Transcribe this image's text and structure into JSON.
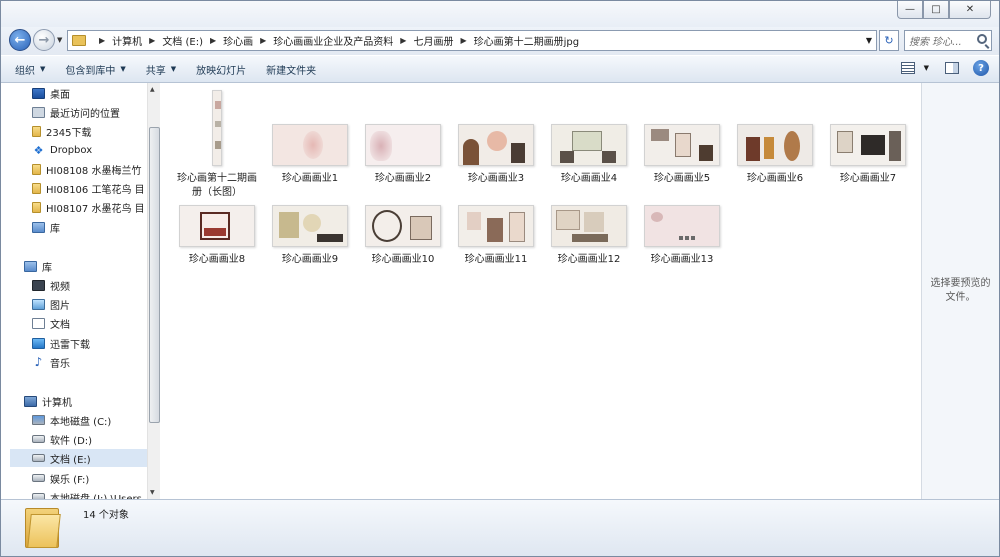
{
  "window": {
    "controls": {
      "minimize": "—",
      "maximize": "□",
      "close": "✕"
    }
  },
  "address": {
    "segments": [
      "计算机",
      "文档 (E:)",
      "珍心画",
      "珍心画画业企业及产品资料",
      "七月画册",
      "珍心画第十二期画册jpg"
    ],
    "search_placeholder": "搜索 珍心..."
  },
  "toolbar": {
    "organize": "组织",
    "include_library": "包含到库中",
    "share": "共享",
    "slideshow": "放映幻灯片",
    "new_folder": "新建文件夹"
  },
  "sidebar": {
    "items": [
      {
        "label": "桌面",
        "icon": "desktop-icon"
      },
      {
        "label": "最近访问的位置",
        "icon": "recent-places-icon"
      },
      {
        "label": "2345下载",
        "icon": "folder-icon"
      },
      {
        "label": "Dropbox",
        "icon": "dropbox-icon"
      },
      {
        "label": "HI08108 水墨梅兰竹",
        "icon": "folder-icon"
      },
      {
        "label": "HI08106 工笔花鸟 目",
        "icon": "folder-icon"
      },
      {
        "label": "HI08107 水墨花鸟 目",
        "icon": "folder-icon"
      },
      {
        "label": "库",
        "icon": "library-icon"
      },
      {
        "label": "库",
        "icon": "library-icon"
      },
      {
        "label": "视频",
        "icon": "video-icon"
      },
      {
        "label": "图片",
        "icon": "pictures-icon"
      },
      {
        "label": "文档",
        "icon": "documents-icon"
      },
      {
        "label": "迅雷下载",
        "icon": "thunder-download-icon"
      },
      {
        "label": "音乐",
        "icon": "music-icon"
      },
      {
        "label": "计算机",
        "icon": "computer-icon"
      },
      {
        "label": "本地磁盘 (C:)",
        "icon": "drive-c-icon"
      },
      {
        "label": "软件 (D:)",
        "icon": "drive-icon"
      },
      {
        "label": "文档 (E:)",
        "icon": "drive-icon"
      },
      {
        "label": "娱乐 (F:)",
        "icon": "drive-icon"
      },
      {
        "label": "本地磁盘 (I:) \\Users",
        "icon": "drive-icon"
      }
    ]
  },
  "files": [
    {
      "name": "珍心画第十二期画册（长图）",
      "bg": "#f2ede8"
    },
    {
      "name": "珍心画画业1",
      "bg": "#f3e6e2"
    },
    {
      "name": "珍心画画业2",
      "bg": "#f6eeee"
    },
    {
      "name": "珍心画画业3",
      "bg": "#f1ece7"
    },
    {
      "name": "珍心画画业4",
      "bg": "#f0ede6"
    },
    {
      "name": "珍心画画业5",
      "bg": "#f2eeea"
    },
    {
      "name": "珍心画画业6",
      "bg": "#eeeae6"
    },
    {
      "name": "珍心画画业7",
      "bg": "#f3f0ec"
    },
    {
      "name": "珍心画画业8",
      "bg": "#f4efec"
    },
    {
      "name": "珍心画画业9",
      "bg": "#f1ede6"
    },
    {
      "name": "珍心画画业10",
      "bg": "#f3eeea"
    },
    {
      "name": "珍心画画业11",
      "bg": "#f2eee9"
    },
    {
      "name": "珍心画画业12",
      "bg": "#f0ebe4"
    },
    {
      "name": "珍心画画业13",
      "bg": "#f1e3e3"
    }
  ],
  "preview": {
    "message": "选择要预览的文件。"
  },
  "status": {
    "count": "14 个对象"
  }
}
